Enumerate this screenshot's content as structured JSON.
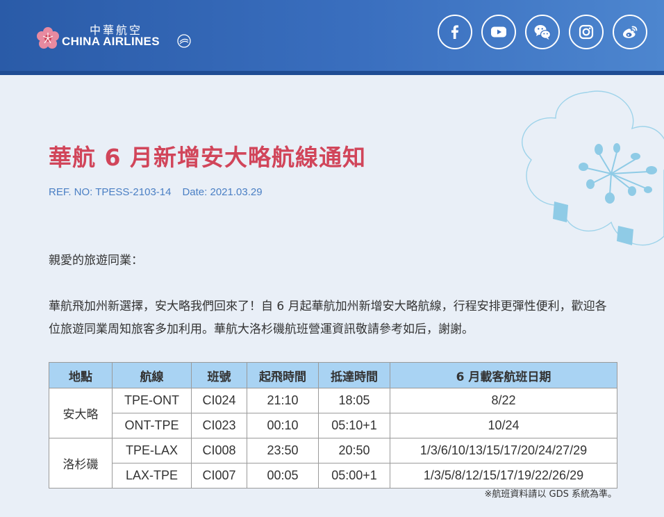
{
  "brand": {
    "name_zh": "中華航空",
    "name_en": "CHINA AIRLINES"
  },
  "social": [
    {
      "name": "facebook-icon",
      "label": "Facebook"
    },
    {
      "name": "youtube-icon",
      "label": "YouTube"
    },
    {
      "name": "wechat-icon",
      "label": "WeChat"
    },
    {
      "name": "instagram-icon",
      "label": "Instagram"
    },
    {
      "name": "weibo-icon",
      "label": "Weibo"
    }
  ],
  "title": "華航 6 月新增安大略航線通知",
  "ref": {
    "ref_no": "REF. NO: TPESS-2103-14",
    "date": "Date: 2021.03.29"
  },
  "greeting": "親愛的旅遊同業：",
  "body": "華航飛加州新選擇，安大略我們回來了！自 6 月起華航加州新增安大略航線，行程安排更彈性便利，歡迎各位旅遊同業周知旅客多加利用。華航大洛杉磯航班營運資訊敬請參考如后，謝謝。",
  "table": {
    "headers": [
      "地點",
      "航線",
      "班號",
      "起飛時間",
      "抵達時間",
      "6 月載客航班日期"
    ],
    "groups": [
      {
        "location": "安大略",
        "rows": [
          {
            "route": "TPE-ONT",
            "flight": "CI024",
            "dep": "21:10",
            "arr": "18:05",
            "dates": "8/22"
          },
          {
            "route": "ONT-TPE",
            "flight": "CI023",
            "dep": "00:10",
            "arr": "05:10+1",
            "dates": "10/24"
          }
        ]
      },
      {
        "location": "洛杉磯",
        "rows": [
          {
            "route": "TPE-LAX",
            "flight": "CI008",
            "dep": "23:50",
            "arr": "20:50",
            "dates": "1/3/6/10/13/15/17/20/24/27/29"
          },
          {
            "route": "LAX-TPE",
            "flight": "CI007",
            "dep": "00:05",
            "arr": "05:00+1",
            "dates": "1/3/5/8/12/15/17/19/22/26/29"
          }
        ]
      }
    ]
  },
  "note": "※航班資料請以 GDS 系統為準。",
  "colors": {
    "header": "#3a6fbf",
    "title": "#d1455a",
    "ref": "#4a7fc4",
    "table_header": "#a9d3f3"
  }
}
